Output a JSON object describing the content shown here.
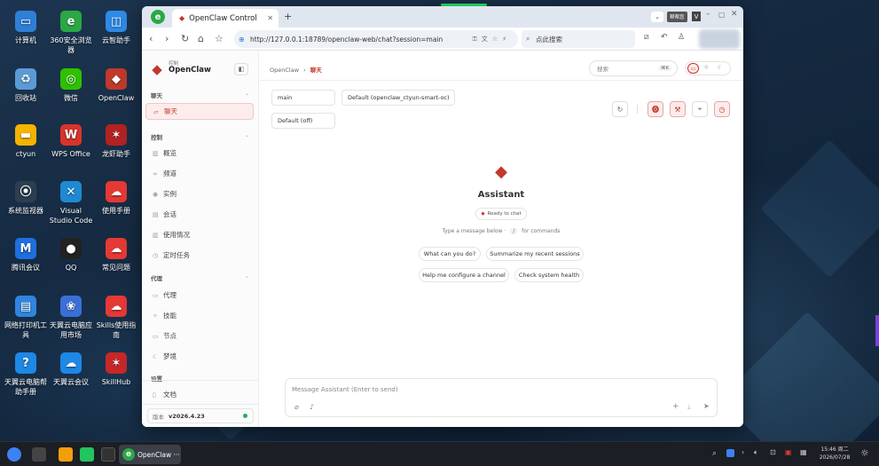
{
  "desktop": {
    "icons": [
      {
        "name": "computer",
        "label": "计算机",
        "glyph": "▭",
        "color": "#2f7fd6"
      },
      {
        "name": "browser-360",
        "label": "360安全浏览器",
        "glyph": "e",
        "color": "#2aa845"
      },
      {
        "name": "cloud-assistant",
        "label": "云智助手",
        "glyph": "◫",
        "color": "#2e8ae6"
      },
      {
        "name": "recycle-bin",
        "label": "回收站",
        "glyph": "♻",
        "color": "#5b9bd5"
      },
      {
        "name": "wechat",
        "label": "微信",
        "glyph": "◎",
        "color": "#2dc100"
      },
      {
        "name": "openclaw",
        "label": "OpenClaw",
        "glyph": "◆",
        "color": "#c0392b"
      },
      {
        "name": "ctyun-folder",
        "label": "ctyun",
        "glyph": "▬",
        "color": "#f4b400"
      },
      {
        "name": "wps-office",
        "label": "WPS Office",
        "glyph": "W",
        "color": "#d9342b"
      },
      {
        "name": "lobster-assistant",
        "label": "龙虾助手",
        "glyph": "✶",
        "color": "#b22222"
      },
      {
        "name": "system-monitor",
        "label": "系统监视器",
        "glyph": "⦿",
        "color": "#2c3e50"
      },
      {
        "name": "vscode",
        "label": "Visual Studio Code",
        "glyph": "✕",
        "color": "#1f8ad2"
      },
      {
        "name": "user-manual",
        "label": "使用手册",
        "glyph": "☁",
        "color": "#e53935"
      },
      {
        "name": "tencent-meeting",
        "label": "腾讯会议",
        "glyph": "M",
        "color": "#1e6fe0"
      },
      {
        "name": "qq",
        "label": "QQ",
        "glyph": "●",
        "color": "#222"
      },
      {
        "name": "faq",
        "label": "常见问题",
        "glyph": "☁",
        "color": "#e53935"
      },
      {
        "name": "network-printer",
        "label": "网络打印机工具",
        "glyph": "▤",
        "color": "#2e86de"
      },
      {
        "name": "app-market",
        "label": "天翼云电脑应用市场",
        "glyph": "❀",
        "color": "#3b6fd8"
      },
      {
        "name": "skills-guide",
        "label": "Skills使用指南",
        "glyph": "☁",
        "color": "#e53935"
      },
      {
        "name": "help-manual",
        "label": "天翼云电脑帮助手册",
        "glyph": "?",
        "color": "#1e88e5"
      },
      {
        "name": "cloud-meeting",
        "label": "天翼云会议",
        "glyph": "☁",
        "color": "#1e88e5"
      },
      {
        "name": "skillhub",
        "label": "SkillHub",
        "glyph": "✶",
        "color": "#c62828"
      }
    ]
  },
  "browser": {
    "tab_title": "OpenClaw Control",
    "new_tab": "+",
    "url": "http://127.0.0.1:18789/openclaw-web/chat?session=main",
    "search_placeholder": "点此搜索",
    "profile_label": "帮帮您"
  },
  "sidebar": {
    "brand_sub": "控制",
    "brand": "OpenClaw",
    "sections": {
      "chat": "聊天",
      "control": "控制",
      "agent": "代理",
      "settings": "设置"
    },
    "items": {
      "chat": "聊天",
      "overview": "概览",
      "channels": "频道",
      "instances": "实例",
      "sessions": "会话",
      "usage": "使用情况",
      "cron": "定时任务",
      "agents": "代理",
      "skills": "技能",
      "nodes": "节点",
      "dreams": "梦境",
      "docs": "文档"
    },
    "version_label": "版本",
    "version": "v2026.4.23"
  },
  "main": {
    "breadcrumb_root": "OpenClaw",
    "breadcrumb_sep": "›",
    "breadcrumb_current": "聊天",
    "search_placeholder": "搜索",
    "search_shortcut": "⌘K",
    "session_select": "main",
    "model_select": "Default (openclaw_ctyun-smart-oc)",
    "thinking_select": "Default (off)",
    "assistant_title": "Assistant",
    "status": "Ready to chat",
    "hint_prefix": "Type a message below ·",
    "hint_key": "/",
    "hint_suffix": "for commands",
    "suggestions": [
      "What can you do?",
      "Summarize my recent sessions",
      "Help me configure a channel",
      "Check system health"
    ],
    "composer_placeholder": "Message Assistant (Enter to send)"
  },
  "taskbar": {
    "active_app": "OpenClaw ···",
    "time": "15:46 周二",
    "date": "2026/07/28"
  },
  "colors": {
    "accent": "#c0392b",
    "active_bg": "#fdecec"
  }
}
